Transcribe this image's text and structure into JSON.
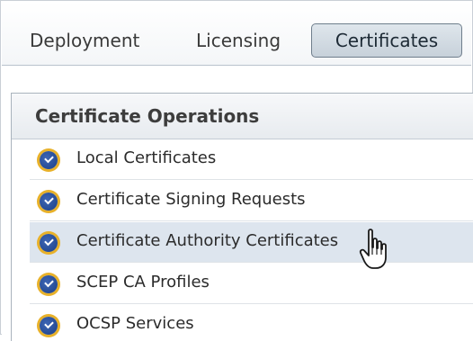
{
  "tabs": [
    {
      "label": "Deployment",
      "active": false
    },
    {
      "label": "Licensing",
      "active": false
    },
    {
      "label": "Certificates",
      "active": true
    }
  ],
  "panel": {
    "title": "Certificate Operations",
    "items": [
      {
        "label": "Local Certificates",
        "icon": "certificate-badge-icon",
        "highlighted": false
      },
      {
        "label": "Certificate Signing Requests",
        "icon": "certificate-badge-icon",
        "highlighted": false
      },
      {
        "label": "Certificate Authority Certificates",
        "icon": "certificate-badge-icon",
        "highlighted": true
      },
      {
        "label": "SCEP CA Profiles",
        "icon": "certificate-badge-icon",
        "highlighted": false
      },
      {
        "label": "OCSP Services",
        "icon": "certificate-badge-icon",
        "highlighted": false
      }
    ]
  },
  "colors": {
    "active_tab_bg": "#c7d1da",
    "highlight_row": "#dde5ee",
    "icon_blue": "#1b3f86",
    "icon_gold": "#e8b12a"
  }
}
